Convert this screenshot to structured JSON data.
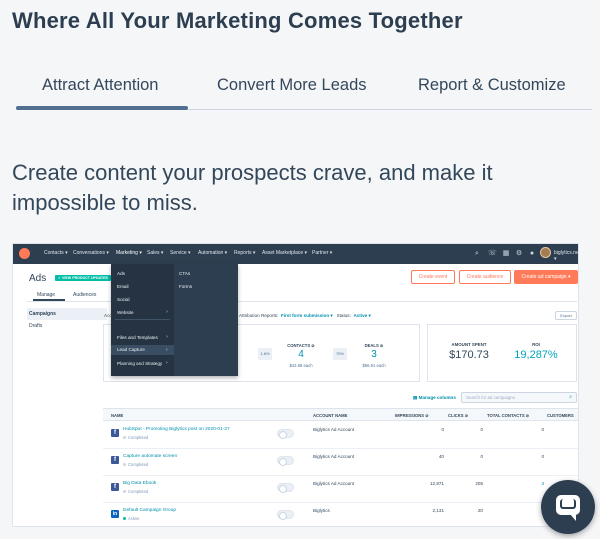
{
  "headline": "Where All Your Marketing Comes Together",
  "tabs": [
    {
      "label": "Attract Attention"
    },
    {
      "label": "Convert More Leads"
    },
    {
      "label": "Report & Customize"
    }
  ],
  "lede": "Create content your prospects crave, and make it impossible to miss.",
  "app": {
    "nav": [
      "Contacts ▾",
      "Conversations ▾",
      "Marketing ▾",
      "Sales ▾",
      "Service ▾",
      "Automation ▾",
      "Reports ▾",
      "Asset Marketplace ▾",
      "Partner ▾"
    ],
    "account": "biglytics.net ▾",
    "page_title": "Ads",
    "badge": "✓ VIEW PRODUCT UPDATES",
    "subtabs": [
      "Manage",
      "Audiences"
    ],
    "buttons": {
      "create_event": "Create event",
      "create_audience": "Create audience",
      "create_campaign": "Create ad campaign ▾"
    },
    "sidebar": [
      "Campaigns",
      "Drafts"
    ],
    "filters": {
      "acc_label": "Acc",
      "attribution_label": "Attribution Reports:",
      "attribution_value": "First form submission ▾",
      "status_label": "Status:",
      "status_value": "Active ▾"
    },
    "export": "Export",
    "funnel": {
      "rate1": "1.8%",
      "contacts_label": "CONTACTS ⊘",
      "contacts_value": "4",
      "contacts_sub": "$42.68 each",
      "rate2": "75%",
      "deals_label": "DEALS ⊘",
      "deals_value": "3",
      "deals_sub": "$56.91 each"
    },
    "summary": {
      "spent_label": "AMOUNT SPENT",
      "spent_value": "$170.73",
      "roi_label": "ROI",
      "roi_value": "19,287%"
    },
    "manage_columns": "▤ Manage columns",
    "search_placeholder": "Search for ad campaigns",
    "columns": [
      "NAME",
      "ACCOUNT NAME",
      "IMPRESSIONS ⊘",
      "CLICKS ⊘",
      "TOTAL CONTACTS ⊘",
      "CUSTOMERS"
    ],
    "rows": [
      {
        "network": "f",
        "name": "HubSpot - Promoting Biglytics post on 2020-01-27",
        "status": "Completed",
        "account": "Biglytics Ad Account",
        "impressions": "0",
        "clicks": "0",
        "contacts": "0",
        "customers": ""
      },
      {
        "network": "f",
        "name": "Capture automate screen",
        "status": "Completed",
        "account": "Biglytics Ad Account",
        "impressions": "40",
        "clicks": "0",
        "contacts": "0",
        "customers": ""
      },
      {
        "network": "f",
        "name": "Big Data Ebook",
        "status": "Completed",
        "account": "Biglytics Ad Account",
        "impressions": "12,871",
        "clicks": "205",
        "contacts": "3",
        "customers": "2"
      },
      {
        "network": "in",
        "name": "Default Campaign Group",
        "status": "Active",
        "account": "Biglytics",
        "impressions": "2,131",
        "clicks": "20",
        "contacts": "2",
        "customers": ""
      }
    ],
    "marketing_menu": {
      "col1": [
        "Ads",
        "Email",
        "Social",
        "Website",
        "Files and Templates",
        "Lead Capture",
        "Planning and Strategy"
      ],
      "col2": [
        "CTAs",
        "Forms"
      ]
    }
  }
}
